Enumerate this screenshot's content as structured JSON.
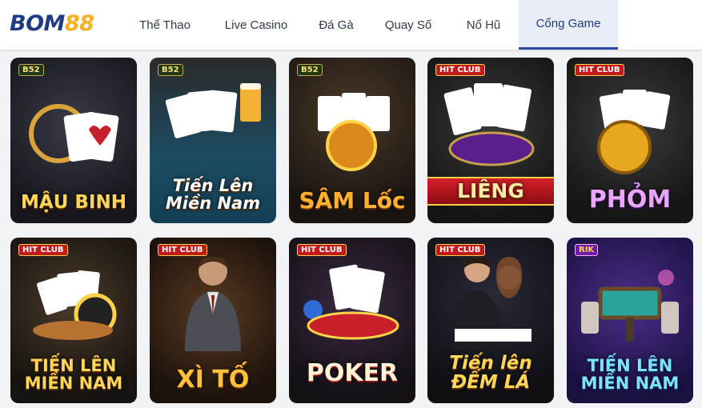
{
  "header": {
    "logo": {
      "part1": "BOM",
      "part2": "88"
    },
    "nav": [
      {
        "label": "Thể Thao"
      },
      {
        "label": "Live Casino"
      },
      {
        "label": "Đá Gà"
      },
      {
        "label": "Quay Số"
      },
      {
        "label": "Nổ Hũ"
      },
      {
        "label": "Cổng Game",
        "active": true
      }
    ]
  },
  "games": [
    {
      "brand": "B52",
      "title": "MẬU BINH"
    },
    {
      "brand": "B52",
      "title": "Tiến Lên Miền Nam"
    },
    {
      "brand": "B52",
      "title": "SÂM Lốc"
    },
    {
      "brand": "HIT CLUB",
      "title": "LIÊNG"
    },
    {
      "brand": "HIT CLUB",
      "title": "PHỎM"
    },
    {
      "brand": "HIT CLUB",
      "title": "TIẾN LÊN MIỀN NAM"
    },
    {
      "brand": "HIT CLUB",
      "title": "XÌ TỐ"
    },
    {
      "brand": "HIT CLUB",
      "title": "POKER"
    },
    {
      "brand": "HIT CLUB",
      "title": "Tiến lên ĐẾM LÁ"
    },
    {
      "brand": "RIK",
      "title": "TIẾN LÊN MIỀN NAM"
    }
  ],
  "colors": {
    "brand_blue": "#1f3b82",
    "brand_gold": "#f5b021",
    "active_tab_bg": "#e9edf6"
  }
}
